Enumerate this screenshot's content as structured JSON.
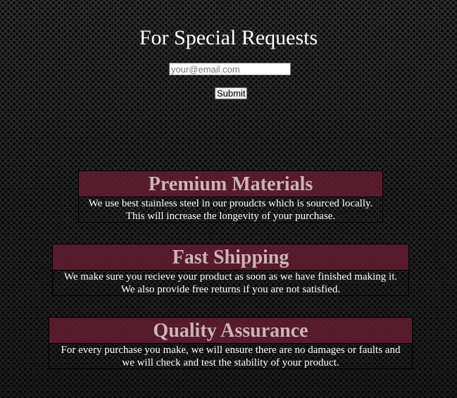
{
  "header": {
    "title": "For Special Requests"
  },
  "form": {
    "email_placeholder": "your@email.com",
    "submit_label": "Submit"
  },
  "features": [
    {
      "heading": "Premium Materials",
      "line1": "We use best stainless steel in our proudcts which is sourced locally.",
      "line2": "This will increase the longevity of your purchase."
    },
    {
      "heading": "Fast Shipping",
      "line1": "We make sure you recieve your product as soon as we have finished making it.",
      "line2": "We also provide free returns if you are not satisfied."
    },
    {
      "heading": "Quality Assurance",
      "line1": "For every purchase you make, we will ensure there are no damages or faults and",
      "line2": "we will check and test the stability of your product."
    }
  ],
  "colors": {
    "heading_band": "#641c30",
    "heading_text": "#c8b5ba",
    "body_text": "#ffffff"
  }
}
